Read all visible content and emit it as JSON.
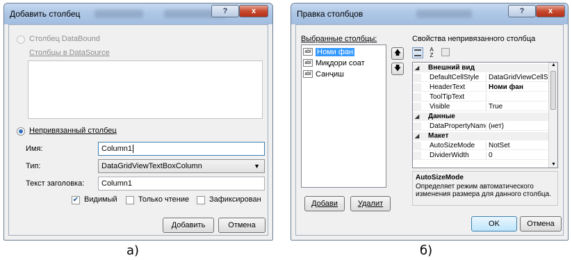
{
  "panel_a": {
    "title": "Добавить столбец",
    "help_glyph": "?",
    "close_glyph": "x",
    "radio_databound_label": "Столбец DataBound",
    "columns_in_datasource_label": "Столбцы в DataSource",
    "radio_unbound_label": "Непривязанный столбец",
    "name_label": "Имя:",
    "name_value": "Column1",
    "type_label": "Тип:",
    "type_value": "DataGridViewTextBoxColumn",
    "header_label": "Текст заголовка:",
    "header_value": "Column1",
    "visible_label": "Видимый",
    "visible_checked": true,
    "readonly_label": "Только чтение",
    "frozen_label": "Зафиксирован",
    "add_button": "Добавить",
    "cancel_button": "Отмена",
    "caption": "а)"
  },
  "panel_b": {
    "title": "Правка столбцов",
    "help_glyph": "?",
    "close_glyph": "x",
    "selected_columns_label": "Выбранные столбцы:",
    "columns": [
      {
        "label": "Номи фан",
        "selected": true
      },
      {
        "label": "Миқдори соат",
        "selected": false
      },
      {
        "label": "Санҷиш",
        "selected": false
      }
    ],
    "unbound_props_label": "Свойства непривязанного столбца",
    "categories": {
      "appearance": "Внешний вид",
      "data": "Данные",
      "layout": "Макет"
    },
    "props": [
      {
        "name": "DefaultCellStyle",
        "value": "DataGridViewCellStyle { }"
      },
      {
        "name": "HeaderText",
        "value": "Номи фан"
      },
      {
        "name": "ToolTipText",
        "value": ""
      },
      {
        "name": "Visible",
        "value": "True"
      },
      {
        "name": "DataPropertyName",
        "value": "(нет)"
      },
      {
        "name": "AutoSizeMode",
        "value": "NotSet"
      },
      {
        "name": "DividerWidth",
        "value": "0"
      }
    ],
    "desc_title": "AutoSizeMode",
    "desc_text": "Определяет режим автоматического изменения размера для данного столбца.",
    "add_button": "Добави",
    "remove_button": "Удалит",
    "ok_button": "OK",
    "cancel_button": "Отмена",
    "caption": "б)"
  }
}
